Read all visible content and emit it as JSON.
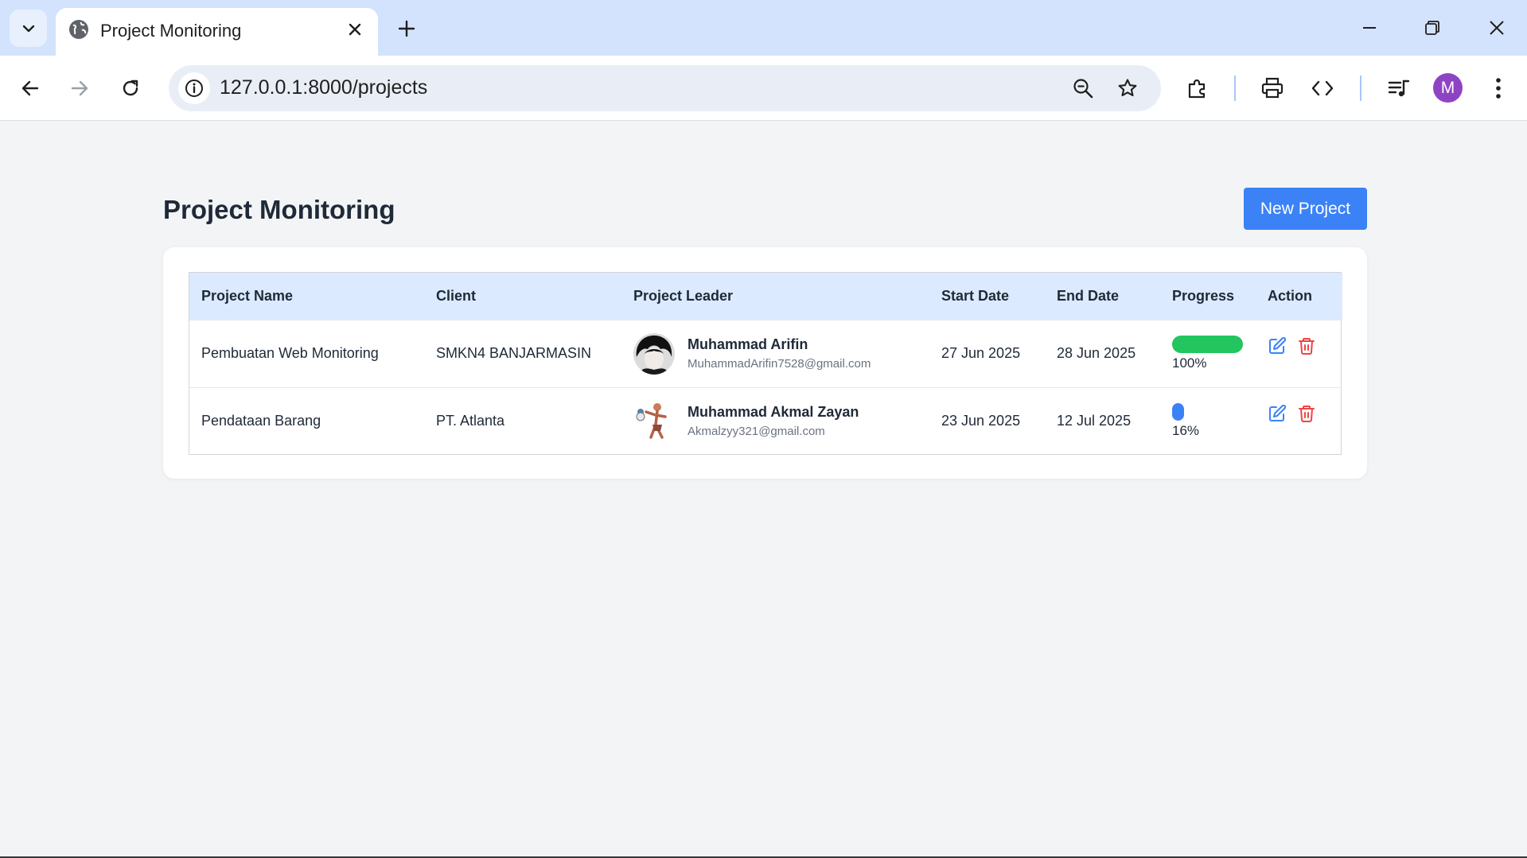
{
  "browser": {
    "tab_title": "Project Monitoring",
    "url": "127.0.0.1:8000/projects",
    "profile_initial": "M",
    "profile_color": "#8e44c2"
  },
  "page": {
    "title": "Project Monitoring",
    "new_project_label": "New Project",
    "accent_color": "#3b82f6"
  },
  "table": {
    "headers": [
      "Project Name",
      "Client",
      "Project Leader",
      "Start Date",
      "End Date",
      "Progress",
      "Action"
    ],
    "rows": [
      {
        "project_name": "Pembuatan Web Monitoring",
        "client": "SMKN4 BANJARMASIN",
        "leader_name": "Muhammad Arifin",
        "leader_email": "MuhammadArifin7528@gmail.com",
        "start_date": "27 Jun 2025",
        "end_date": "28 Jun 2025",
        "progress": 100,
        "progress_label": "100%",
        "progress_color": "#22c55e",
        "icons": [
          "edit-icon",
          "trash-icon"
        ]
      },
      {
        "project_name": "Pendataan Barang",
        "client": "PT. Atlanta",
        "leader_name": "Muhammad Akmal Zayan",
        "leader_email": "Akmalzyy321@gmail.com",
        "start_date": "23 Jun 2025",
        "end_date": "12 Jul 2025",
        "progress": 16,
        "progress_label": "16%",
        "progress_color": "#3b82f6",
        "icons": [
          "edit-icon",
          "trash-icon"
        ]
      }
    ]
  }
}
